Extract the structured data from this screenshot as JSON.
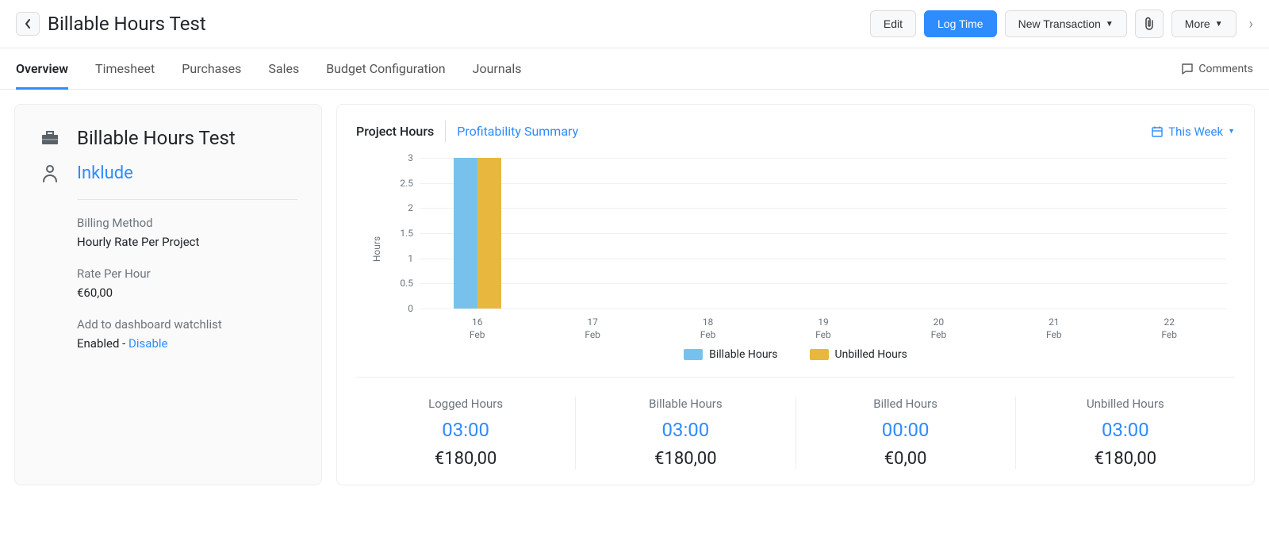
{
  "header": {
    "title": "Billable Hours Test",
    "buttons": {
      "edit": "Edit",
      "log_time": "Log Time",
      "new_transaction": "New Transaction",
      "more": "More"
    }
  },
  "tabs": {
    "items": [
      "Overview",
      "Timesheet",
      "Purchases",
      "Sales",
      "Budget Configuration",
      "Journals"
    ],
    "active": "Overview",
    "comments": "Comments"
  },
  "sidebar": {
    "project_name": "Billable Hours Test",
    "client_name": "Inklude",
    "billing_method_label": "Billing Method",
    "billing_method_value": "Hourly Rate Per Project",
    "rate_label": "Rate Per Hour",
    "rate_value": "€60,00",
    "watchlist_label": "Add to dashboard watchlist",
    "watchlist_status": "Enabled",
    "watchlist_sep": " - ",
    "watchlist_action": "Disable"
  },
  "main": {
    "sub_tabs": {
      "project_hours": "Project Hours",
      "profitability": "Profitability Summary"
    },
    "period": "This Week"
  },
  "chart_data": {
    "type": "bar",
    "y_axis_label": "Hours",
    "ylim": [
      0,
      3
    ],
    "y_ticks": [
      0,
      0.5,
      1,
      1.5,
      2,
      2.5,
      3
    ],
    "categories": [
      {
        "day": "16",
        "month": "Feb"
      },
      {
        "day": "17",
        "month": "Feb"
      },
      {
        "day": "18",
        "month": "Feb"
      },
      {
        "day": "19",
        "month": "Feb"
      },
      {
        "day": "20",
        "month": "Feb"
      },
      {
        "day": "21",
        "month": "Feb"
      },
      {
        "day": "22",
        "month": "Feb"
      }
    ],
    "series": [
      {
        "name": "Billable Hours",
        "class": "billable",
        "values": [
          3,
          0,
          0,
          0,
          0,
          0,
          0
        ]
      },
      {
        "name": "Unbilled Hours",
        "class": "unbilled",
        "values": [
          3,
          0,
          0,
          0,
          0,
          0,
          0
        ]
      }
    ]
  },
  "stats": [
    {
      "label": "Logged Hours",
      "value": "03:00",
      "amount": "€180,00"
    },
    {
      "label": "Billable Hours",
      "value": "03:00",
      "amount": "€180,00"
    },
    {
      "label": "Billed Hours",
      "value": "00:00",
      "amount": "€0,00"
    },
    {
      "label": "Unbilled Hours",
      "value": "03:00",
      "amount": "€180,00"
    }
  ]
}
